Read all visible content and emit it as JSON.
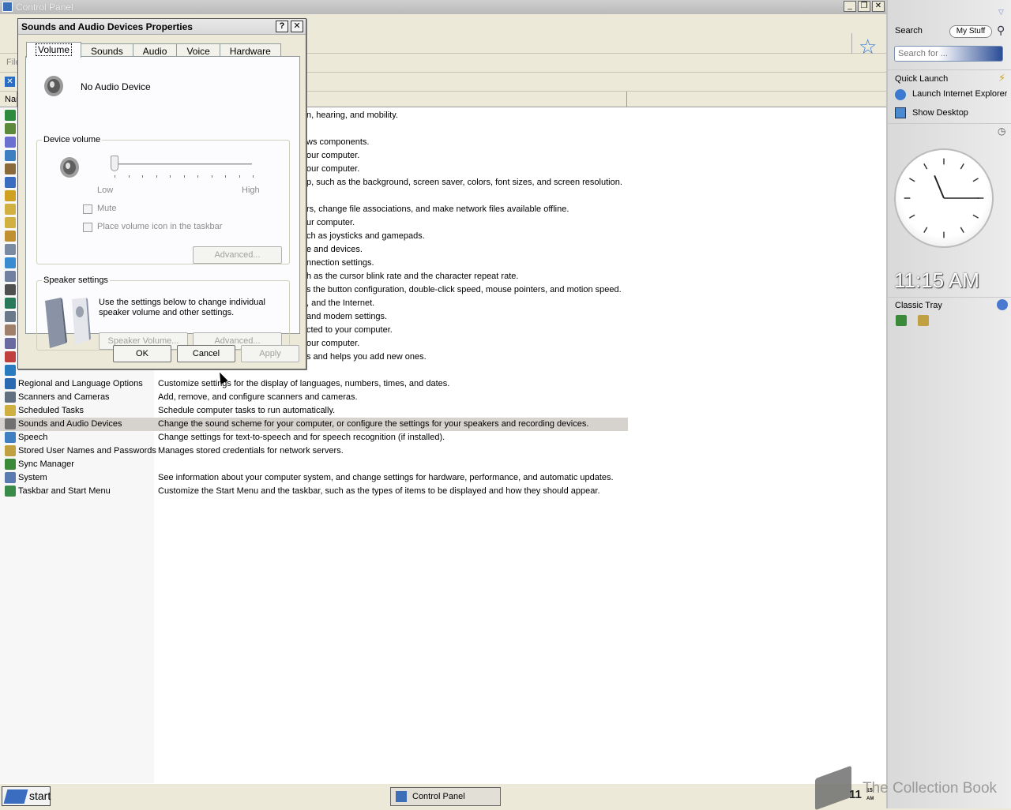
{
  "window": {
    "title": "Control Panel",
    "menu_file": "File"
  },
  "list": {
    "col_name": "Name",
    "rows_partial": [
      {
        "desc": "n, hearing, and mobility.",
        "color": "#2e8b3e"
      },
      {
        "desc": "",
        "color": "#5a8a3a"
      },
      {
        "desc": "ws components.",
        "color": "#6a6fd0"
      },
      {
        "desc": "our computer.",
        "color": "#3d7fc0"
      },
      {
        "desc": "our computer.",
        "color": "#8a6a3a"
      },
      {
        "desc": "p, such as the background, screen saver, colors, font sizes, and screen resolution.",
        "color": "#3a6cc0"
      },
      {
        "desc": "",
        "color": "#d0a020"
      },
      {
        "desc": "rs, change file associations, and make network files available offline.",
        "color": "#d0b040"
      },
      {
        "desc": "ur computer.",
        "color": "#d0b040"
      },
      {
        "desc": "ch as joysticks and gamepads.",
        "color": "#c09030"
      },
      {
        "desc": "e and devices.",
        "color": "#7a8aa0"
      },
      {
        "desc": "nnection settings.",
        "color": "#3a8ad0"
      },
      {
        "desc": "h as the cursor blink rate and the character repeat rate.",
        "color": "#7080a0"
      },
      {
        "desc": "s the button configuration, double-click speed, mouse pointers, and motion speed.",
        "color": "#505050"
      },
      {
        "desc": ", and the Internet.",
        "color": "#2a7a5a"
      },
      {
        "desc": "and modem settings.",
        "color": "#6a7a8a"
      },
      {
        "desc": "cted to your computer.",
        "color": "#a0806a"
      },
      {
        "desc": "our computer.",
        "color": "#6a6aa0"
      },
      {
        "desc": "s and helps you add new ones.",
        "color": "#c04040"
      },
      {
        "desc": "",
        "color": "#2a7ac0"
      }
    ],
    "rows": [
      {
        "name": "Regional and Language Options",
        "desc": "Customize settings for the display of languages, numbers, times, and dates.",
        "color": "#2a6ab0"
      },
      {
        "name": "Scanners and Cameras",
        "desc": "Add, remove, and configure scanners and cameras.",
        "color": "#607080"
      },
      {
        "name": "Scheduled Tasks",
        "desc": "Schedule computer tasks to run automatically.",
        "color": "#d0b040"
      },
      {
        "name": "Sounds and Audio Devices",
        "desc": "Change the sound scheme for your computer, or configure the settings for your speakers and recording devices.",
        "color": "#707070"
      },
      {
        "name": "Speech",
        "desc": "Change settings for text-to-speech and for speech recognition (if installed).",
        "color": "#4080c0"
      },
      {
        "name": "Stored User Names and Passwords",
        "desc": "Manages stored credentials for network servers.",
        "color": "#c0a040"
      },
      {
        "name": "Sync Manager",
        "desc": "",
        "color": "#3a8a3a"
      },
      {
        "name": "System",
        "desc": "See information about your computer system, and change settings for hardware, performance, and automatic updates.",
        "color": "#5a7ab0"
      },
      {
        "name": "Taskbar and Start Menu",
        "desc": "Customize the Start Menu and the taskbar, such as the types of items to be displayed and how they should appear.",
        "color": "#3a8a4a"
      }
    ],
    "selected_index": 3
  },
  "dialog": {
    "title": "Sounds and Audio Devices Properties",
    "help_label": "?",
    "close_label": "✕",
    "tabs": [
      "Volume",
      "Sounds",
      "Audio",
      "Voice",
      "Hardware"
    ],
    "active_tab": "Volume",
    "device_name": "No Audio Device",
    "device_volume_legend": "Device volume",
    "volume_low": "Low",
    "volume_high": "High",
    "volume_level": 0,
    "mute_label": "Mute",
    "place_icon_label": "Place volume icon in the taskbar",
    "advanced_label": "Advanced...",
    "speaker_settings_legend": "Speaker settings",
    "speaker_text": "Use the settings below to change individual speaker volume and other settings.",
    "speaker_volume_label": "Speaker Volume...",
    "speaker_advanced_label": "Advanced...",
    "ok_label": "OK",
    "cancel_label": "Cancel",
    "apply_label": "Apply"
  },
  "sidebar": {
    "search_title": "Search",
    "my_stuff_label": "My Stuff",
    "search_placeholder": "Search for ...",
    "quick_launch_title": "Quick Launch",
    "quick_launch_items": [
      "Launch Internet Explorer Browser",
      "Show Desktop"
    ],
    "digital_time": "11:15 AM",
    "classic_tray_title": "Classic Tray",
    "clock_hour": 11,
    "clock_minute": 15
  },
  "taskbar": {
    "start_label": "start",
    "task_label": "Control Panel",
    "tray_hour": "11",
    "tray_minute": "15",
    "tray_ampm": "AM"
  },
  "watermark": "The Collection Book"
}
